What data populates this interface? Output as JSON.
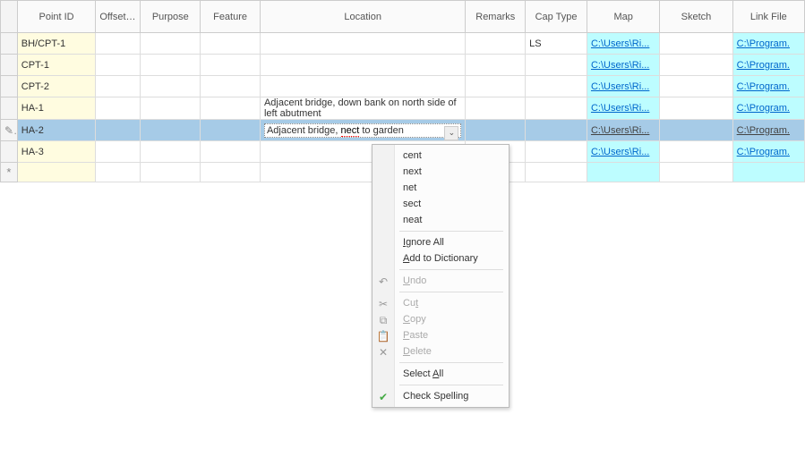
{
  "columns": {
    "point_id": "Point ID",
    "offset": "Offset (m)",
    "purpose": "Purpose",
    "feature": "Feature",
    "location": "Location",
    "remarks": "Remarks",
    "cap_type": "Cap Type",
    "map": "Map",
    "sketch": "Sketch",
    "link_file": "Link File"
  },
  "link_text": {
    "map": "C:\\Users\\Ri...",
    "link": "C:\\Program."
  },
  "rows": [
    {
      "id": "BH/CPT-1",
      "offset": "",
      "purpose": "",
      "feature": "",
      "location": "",
      "remarks": "",
      "cap": "LS",
      "map": true,
      "sketch": "",
      "link": true,
      "mark": ""
    },
    {
      "id": "CPT-1",
      "offset": "",
      "purpose": "",
      "feature": "",
      "location": "",
      "remarks": "",
      "cap": "",
      "map": true,
      "sketch": "",
      "link": true,
      "mark": ""
    },
    {
      "id": "CPT-2",
      "offset": "",
      "purpose": "",
      "feature": "",
      "location": "",
      "remarks": "",
      "cap": "",
      "map": true,
      "sketch": "",
      "link": true,
      "mark": ""
    },
    {
      "id": "HA-1",
      "offset": "",
      "purpose": "",
      "feature": "",
      "location": "Adjacent bridge, down bank on north side of left abutment",
      "remarks": "",
      "cap": "",
      "map": true,
      "sketch": "",
      "link": true,
      "mark": ""
    },
    {
      "id": "HA-2",
      "offset": "",
      "purpose": "",
      "feature": "",
      "location": "",
      "remarks": "",
      "cap": "",
      "map": true,
      "sketch": "",
      "link": true,
      "mark": "pencil",
      "selected": true,
      "editing": true
    },
    {
      "id": "HA-3",
      "offset": "",
      "purpose": "",
      "feature": "",
      "location": "",
      "remarks": "",
      "cap": "",
      "map": true,
      "sketch": "",
      "link": true,
      "mark": ""
    }
  ],
  "editing_cell": {
    "prefix": "Adjacent bridge, ",
    "misspelled": "nect",
    "suffix": " to garden"
  },
  "context_menu": {
    "suggestions": [
      "cent",
      "next",
      "net",
      "sect",
      "neat"
    ],
    "ignore_all": "Ignore All",
    "add_dict": "Add to Dictionary",
    "undo": "Undo",
    "cut": "Cut",
    "copy": "Copy",
    "paste": "Paste",
    "delete": "Delete",
    "select_all": "Select All",
    "check_spelling": "Check Spelling"
  }
}
